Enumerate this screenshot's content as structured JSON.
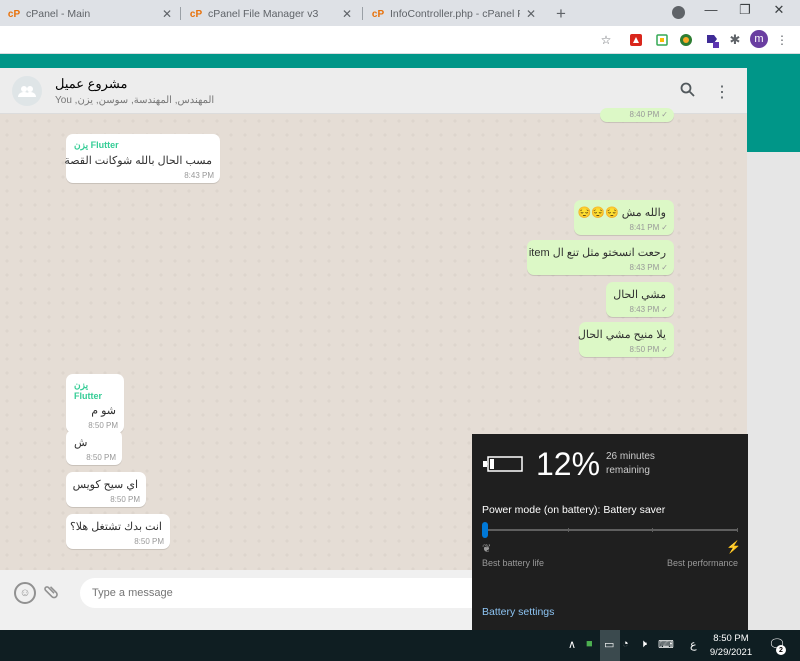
{
  "browser": {
    "tabs": [
      {
        "title": "cPanel - Main"
      },
      {
        "title": "cPanel File Manager v3"
      },
      {
        "title": "InfoController.php - cPanel File M"
      }
    ],
    "new_tab_label": "+",
    "window": {
      "minimize": "—",
      "maximize": "❐",
      "close": "✕"
    },
    "profile_initial": "m"
  },
  "chat": {
    "name": "مشروع عميل",
    "members": "You ,المهندس, المهندسة, سوسن, يزن",
    "messages": {
      "partial_out_time": "8:40 PM",
      "m1": {
        "sender": "يزن Flutter",
        "text": "مسب الحال بالله شوكانت القصة",
        "time": "8:43 PM"
      },
      "m2": {
        "text": "والله مش 😔😔😔",
        "time": "8:41 PM"
      },
      "m3": {
        "text": "رحعت انسختو مثل تنع ال item",
        "time": "8:43 PM"
      },
      "m4": {
        "text": "مشي الحال",
        "time": "8:43 PM"
      },
      "m5": {
        "text": "يلا منيح مشي الحال",
        "time": "8:50 PM"
      },
      "m6": {
        "sender": "يزن Flutter",
        "text": "شو م",
        "time": "8:50 PM"
      },
      "m7": {
        "text": "ش",
        "time": "8:50 PM"
      },
      "m8": {
        "text": "اي سيح كويس",
        "time": "8:50 PM"
      },
      "m9": {
        "text": "انت بدك تشتغل هلا؟",
        "time": "8:50 PM"
      }
    },
    "composer_placeholder": "Type a message"
  },
  "battery": {
    "percent": "12%",
    "remaining": "26 minutes remaining",
    "mode": "Power mode (on battery): Battery saver",
    "mode_level": 0,
    "label_left": "Best battery life",
    "label_right": "Best performance",
    "settings_link": "Battery settings"
  },
  "taskbar": {
    "time": "8:50 PM",
    "date": "9/29/2021",
    "language": "ع",
    "notification_count": "2"
  }
}
